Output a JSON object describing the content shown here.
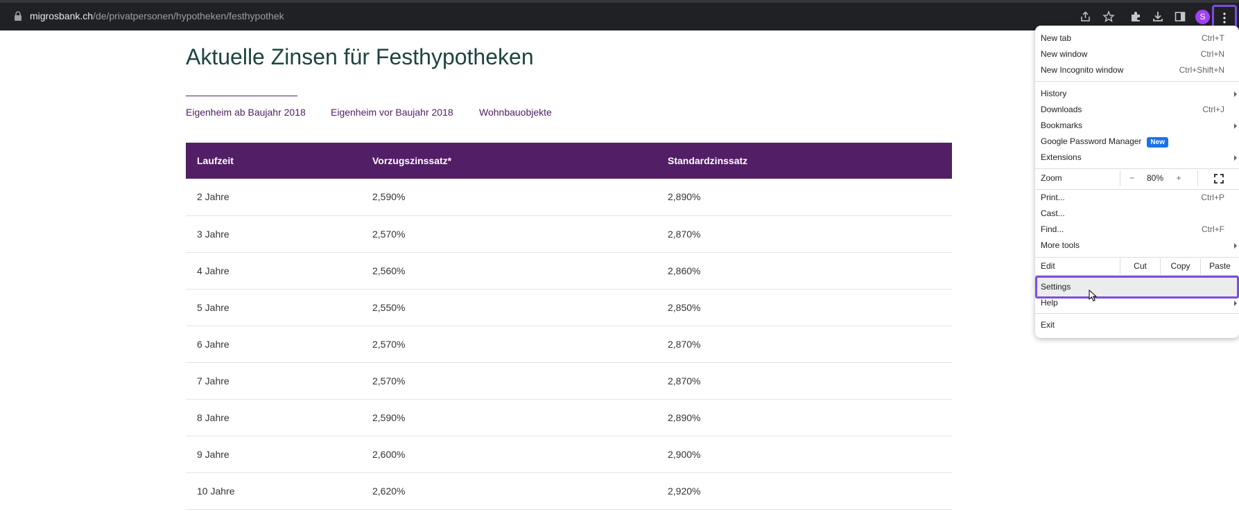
{
  "browser": {
    "url_host": "migrosbank.ch",
    "url_path": "/de/privatpersonen/hypotheken/festhypothek",
    "profile_initial": "S"
  },
  "page": {
    "title": "Aktuelle Zinsen für Festhypotheken",
    "tabs": [
      "Eigenheim ab Baujahr 2018",
      "Eigenheim vor Baujahr 2018",
      "Wohnbauobjekte"
    ],
    "table": {
      "headers": [
        "Laufzeit",
        "Vorzugszinssatz*",
        "Standardzinssatz"
      ],
      "rows": [
        [
          "2 Jahre",
          "2,590%",
          "2,890%"
        ],
        [
          "3 Jahre",
          "2,570%",
          "2,870%"
        ],
        [
          "4 Jahre",
          "2,560%",
          "2,860%"
        ],
        [
          "5 Jahre",
          "2,550%",
          "2,850%"
        ],
        [
          "6 Jahre",
          "2,570%",
          "2,870%"
        ],
        [
          "7 Jahre",
          "2,570%",
          "2,870%"
        ],
        [
          "8 Jahre",
          "2,590%",
          "2,890%"
        ],
        [
          "9 Jahre",
          "2,600%",
          "2,900%"
        ],
        [
          "10 Jahre",
          "2,620%",
          "2,920%"
        ]
      ]
    }
  },
  "menu": {
    "new_tab": {
      "label": "New tab",
      "shortcut": "Ctrl+T"
    },
    "new_window": {
      "label": "New window",
      "shortcut": "Ctrl+N"
    },
    "new_incognito": {
      "label": "New Incognito window",
      "shortcut": "Ctrl+Shift+N"
    },
    "history": "History",
    "downloads": {
      "label": "Downloads",
      "shortcut": "Ctrl+J"
    },
    "bookmarks": "Bookmarks",
    "password_manager": "Google Password Manager",
    "password_badge": "New",
    "extensions": "Extensions",
    "zoom": {
      "label": "Zoom",
      "minus": "−",
      "value": "80%",
      "plus": "+"
    },
    "print": {
      "label": "Print...",
      "shortcut": "Ctrl+P"
    },
    "cast": "Cast...",
    "find": {
      "label": "Find...",
      "shortcut": "Ctrl+F"
    },
    "more_tools": "More tools",
    "edit": {
      "label": "Edit",
      "cut": "Cut",
      "copy": "Copy",
      "paste": "Paste"
    },
    "settings": "Settings",
    "help": "Help",
    "exit": "Exit"
  },
  "colors": {
    "table_header": "#521e66",
    "title": "#1e4440",
    "tab_text": "#4e1d63",
    "highlight": "#7b4ee2",
    "badge": "#1a73e8"
  }
}
